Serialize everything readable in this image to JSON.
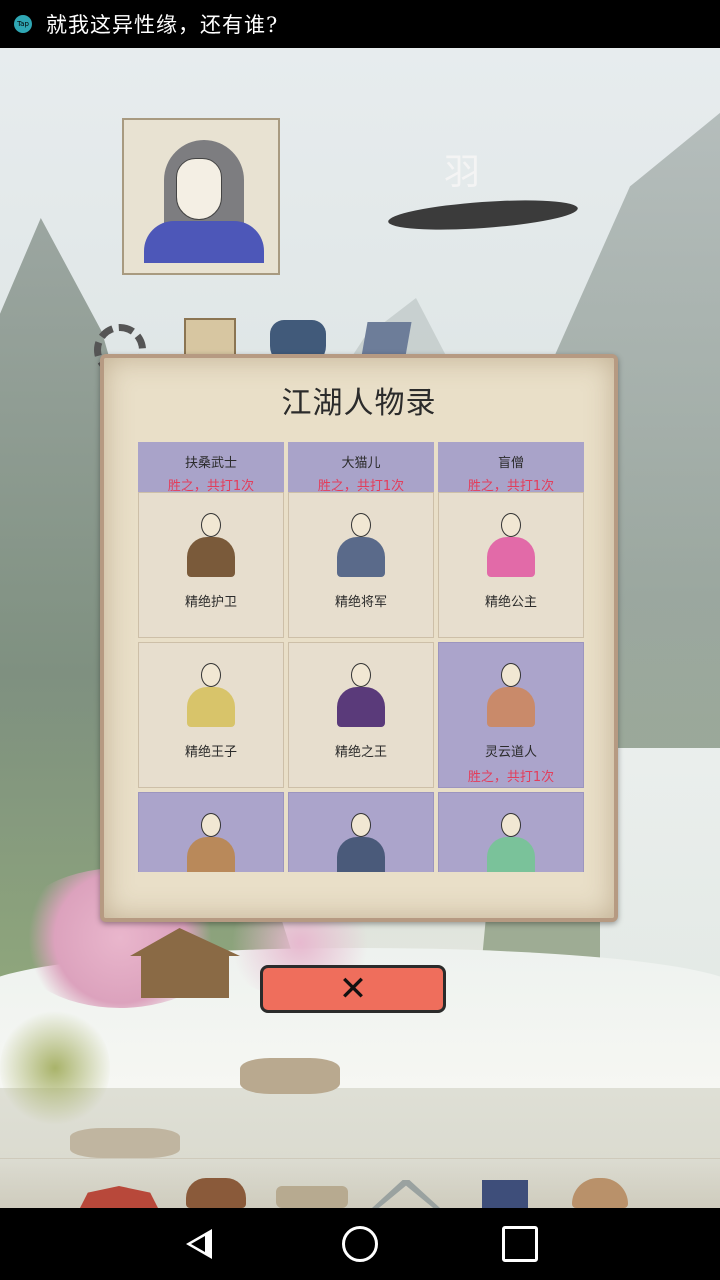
{
  "status_bar": {
    "app_icon": "tap-icon",
    "app_icon_text": "Tap",
    "message": "就我这异性缘，还有谁?"
  },
  "player": {
    "name": "羽"
  },
  "menu_icons": [
    "gear-icon",
    "book-icon",
    "jar-icon",
    "scroll-icon"
  ],
  "dialog": {
    "title": "江湖人物录",
    "top_row": [
      {
        "name": "扶桑武士",
        "status": "胜之，共打1次"
      },
      {
        "name": "大猫儿",
        "status": "胜之，共打1次"
      },
      {
        "name": "盲僧",
        "status": "胜之，共打1次"
      }
    ],
    "cards": [
      {
        "name": "精绝护卫",
        "status": "",
        "defeated": false,
        "color": "#7a5a3a"
      },
      {
        "name": "精绝将军",
        "status": "",
        "defeated": false,
        "color": "#5a6a8a"
      },
      {
        "name": "精绝公主",
        "status": "",
        "defeated": false,
        "color": "#e26aa8"
      },
      {
        "name": "精绝王子",
        "status": "",
        "defeated": false,
        "color": "#d8c46a"
      },
      {
        "name": "精绝之王",
        "status": "",
        "defeated": false,
        "color": "#5a3a7a"
      },
      {
        "name": "灵云道人",
        "status": "胜之，共打1次",
        "defeated": true,
        "color": "#c98a6a"
      },
      {
        "name": "",
        "status": "",
        "defeated": true,
        "color": "#b9895a"
      },
      {
        "name": "",
        "status": "",
        "defeated": true,
        "color": "#4a5a7a"
      },
      {
        "name": "",
        "status": "",
        "defeated": true,
        "color": "#7ac29a"
      }
    ]
  },
  "close_button": {
    "label": "✕",
    "icon": "close-icon"
  },
  "game_nav": [
    "temple-icon",
    "armor-icon",
    "scroll-icon",
    "swords-icon",
    "book-icon",
    "people-icon"
  ],
  "system_nav": [
    "back-icon",
    "home-icon",
    "recents-icon"
  ],
  "colors": {
    "defeated_bg": "#aba4cb",
    "status_red": "#e33d5b",
    "close_button": "#ef6e5c"
  }
}
